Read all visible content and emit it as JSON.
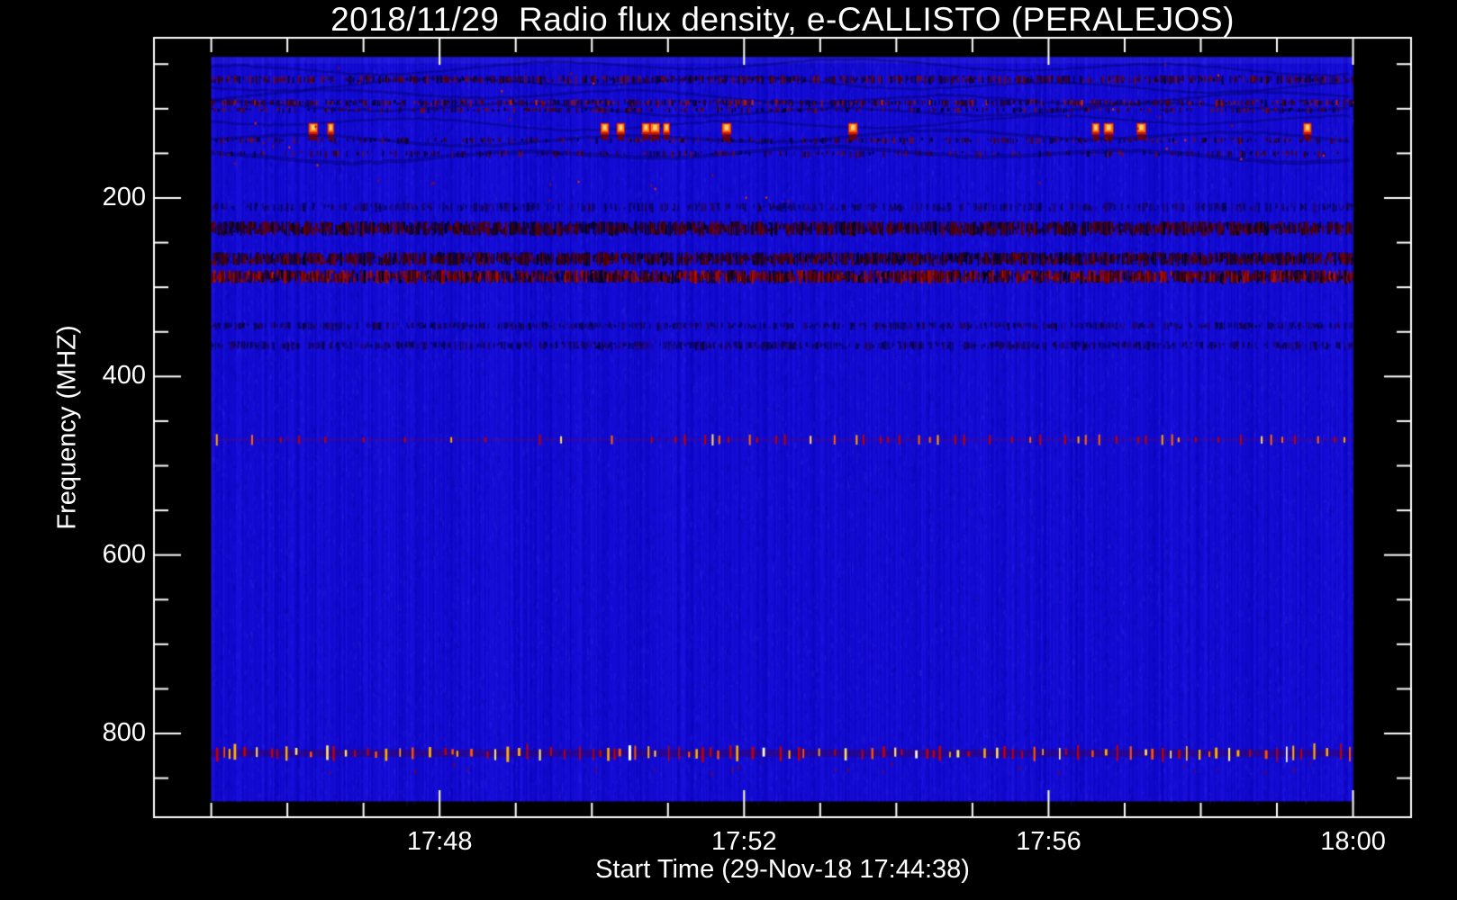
{
  "page": {
    "background": "#000000",
    "text_color": "#ffffff"
  },
  "chart_data": {
    "type": "heatmap",
    "title": "2018/11/29  Radio flux density, e-CALLISTO (PERALEJOS)",
    "xlabel": "Start Time (29-Nov-18 17:44:38)",
    "ylabel": "Frequency (MHZ)",
    "meta": {
      "date": "2018/11/29",
      "instrument": "e-CALLISTO",
      "station": "PERALEJOS",
      "start_time": "17:44:38"
    },
    "x_axis": {
      "major_ticks": [
        {
          "label": "17:48",
          "min_from_1745": 3
        },
        {
          "label": "17:52",
          "min_from_1745": 7
        },
        {
          "label": "17:56",
          "min_from_1745": 11
        },
        {
          "label": "18:00",
          "min_from_1745": 15
        }
      ],
      "minor_tick_every_min": 1,
      "minutes_span": [
        0,
        15
      ],
      "ticks_inward": true
    },
    "y_axis": {
      "unit": "MHZ",
      "major_ticks": [
        200,
        400,
        600,
        800
      ],
      "minor_tick_every_mhz": 50,
      "minor_tick_range_mhz": [
        50,
        850
      ],
      "axis_range_mhz": [
        20,
        894
      ],
      "orientation": "increasing-downward"
    },
    "data_extent": {
      "time_start": "17:45",
      "time_end": "18:00",
      "freq_mhz": [
        42,
        876
      ]
    },
    "colors": {
      "background_flux": "#1a10ee",
      "frame": "#ffffff",
      "rfi_weak": "#7a0000",
      "rfi_strong": "#ff6600",
      "rfi_peak": "#ffe066",
      "rfi_white": "#ffffff"
    },
    "rfi_features": [
      {
        "freq_mhz": 67,
        "kind": "speckle-row",
        "height_mhz": 9,
        "density": 0.5,
        "strength": "dark"
      },
      {
        "freq_mhz": 93,
        "kind": "speckle-row",
        "height_mhz": 7,
        "density": 0.42,
        "strength": "dark-bright"
      },
      {
        "freq_mhz": 101,
        "kind": "speckle-row",
        "height_mhz": 5,
        "density": 0.28,
        "strength": "dark"
      },
      {
        "freq_mhz": 135,
        "kind": "speckle-row",
        "height_mhz": 6,
        "density": 0.22,
        "strength": "dark"
      },
      {
        "freq_mhz": 150,
        "kind": "speckle-row",
        "height_mhz": 6,
        "density": 0.2,
        "strength": "dark"
      },
      {
        "freq_mhz": 210,
        "kind": "speckle-band",
        "height_mhz": 10,
        "density": 0.35,
        "strength": "faint"
      },
      {
        "freq_mhz": 234,
        "kind": "speckle-band",
        "height_mhz": 16,
        "density": 0.85,
        "strength": "dense"
      },
      {
        "freq_mhz": 268,
        "kind": "speckle-band",
        "height_mhz": 15,
        "density": 0.85,
        "strength": "dense"
      },
      {
        "freq_mhz": 288,
        "kind": "speckle-band",
        "height_mhz": 15,
        "density": 0.9,
        "strength": "dense-red"
      },
      {
        "freq_mhz": 343,
        "kind": "speckle-band",
        "height_mhz": 8,
        "density": 0.4,
        "strength": "faint"
      },
      {
        "freq_mhz": 365,
        "kind": "speckle-band",
        "height_mhz": 9,
        "density": 0.45,
        "strength": "faint"
      },
      {
        "freq_mhz": 471,
        "kind": "tick-line",
        "strength": "sparse"
      },
      {
        "freq_mhz": 822,
        "kind": "tick-line",
        "strength": "dense"
      }
    ],
    "bursts_124mhz_min": [
      1.34,
      1.57,
      5.17,
      5.38,
      5.71,
      5.83,
      5.98,
      6.77,
      8.43,
      11.62,
      11.79,
      12.22,
      14.4
    ]
  }
}
